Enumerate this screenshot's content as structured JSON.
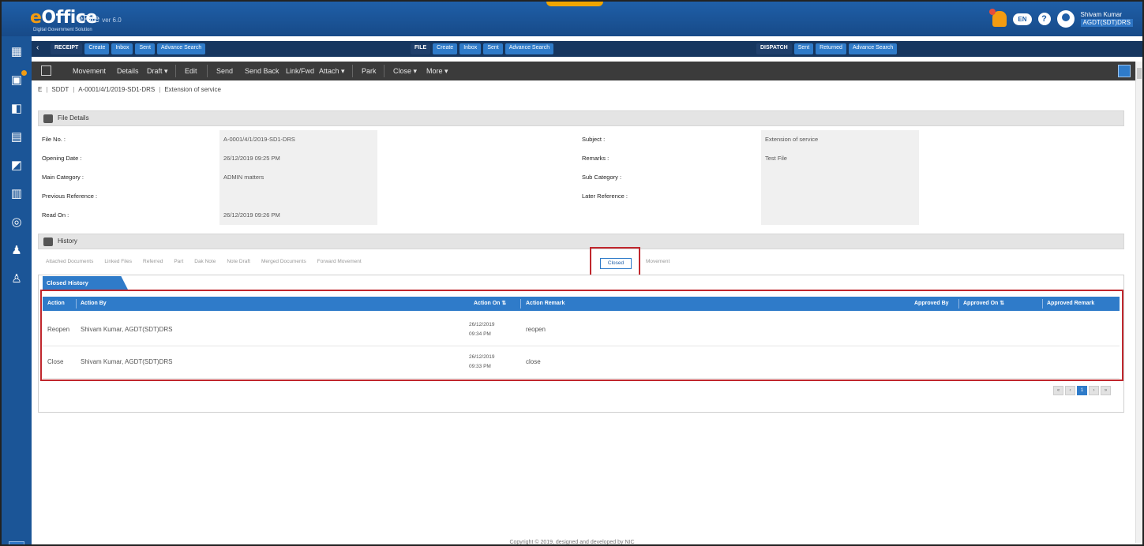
{
  "header": {
    "logo": "Office",
    "logo_letter": "e",
    "logo_tagline": "Digital Government Solution",
    "app_name": "eFile",
    "app_version": "ver 6.0",
    "pill_label": "EN",
    "help_label": "?",
    "user_name": "Shivam Kumar",
    "user_designation": "AGDT(SDT)DRS"
  },
  "modules": {
    "receipt": {
      "title": "RECEIPT",
      "items": [
        "Create",
        "Inbox",
        "Sent",
        "Advance Search"
      ]
    },
    "file": {
      "title": "FILE",
      "items": [
        "Create",
        "Inbox",
        "Sent",
        "Advance Search"
      ]
    },
    "dispatch": {
      "title": "DISPATCH",
      "items": [
        "Sent",
        "Returned",
        "Advance Search"
      ]
    }
  },
  "toolbar": {
    "items": [
      "Movement",
      "Details",
      "Draft ▾",
      "Edit",
      "Send",
      "Send Back",
      "Link/Fwd",
      "Attach ▾",
      "Park",
      "Close ▾",
      "More ▾"
    ]
  },
  "breadcrumb": {
    "home": "E",
    "dept": "SDDT",
    "file_no": "A-0001/4/1/2019-SD1-DRS",
    "subject": "Extension of service"
  },
  "file_details": {
    "section_title": "File Details",
    "left": [
      {
        "label": "File No. :",
        "value": "A-0001/4/1/2019-SD1-DRS"
      },
      {
        "label": "Opening Date :",
        "value": "26/12/2019 09:25 PM"
      },
      {
        "label": "Main Category :",
        "value": "ADMIN matters"
      },
      {
        "label": "Previous Reference :",
        "value": ""
      },
      {
        "label": "Read On :",
        "value": "26/12/2019 09:26 PM"
      }
    ],
    "right": [
      {
        "label": "Subject :",
        "value": "Extension of service"
      },
      {
        "label": "Remarks :",
        "value": "Test File"
      },
      {
        "label": "Sub Category :",
        "value": ""
      },
      {
        "label": "Later Reference :",
        "value": ""
      }
    ]
  },
  "history": {
    "section_title": "History",
    "tabs": [
      "Attached Documents",
      "Linked Files",
      "Referred",
      "Part",
      "Dak Note",
      "Note Draft",
      "Merged Documents",
      "Forward Movement",
      "Closed",
      "Movement"
    ],
    "active_tab": "Closed"
  },
  "closed_history": {
    "panel_title": "Closed History",
    "columns": {
      "action": "Action",
      "action_by": "Action By",
      "action_on": "Action On ⇅",
      "action_remark": "Action Remark",
      "approved_by": "Approved By",
      "approved_on": "Approved On ⇅",
      "approved_remark": "Approved Remark"
    },
    "rows": [
      {
        "action": "Reopen",
        "action_by": "Shivam Kumar, AGDT(SDT)DRS",
        "date": "26/12/2019",
        "time": "09:34 PM",
        "remark": "reopen"
      },
      {
        "action": "Close",
        "action_by": "Shivam Kumar, AGDT(SDT)DRS",
        "date": "26/12/2019",
        "time": "09:33 PM",
        "remark": "close"
      }
    ],
    "pager": [
      "«",
      "‹",
      "1",
      "›",
      "»"
    ]
  },
  "footer": "Copyright © 2019, designed and developed by NIC"
}
